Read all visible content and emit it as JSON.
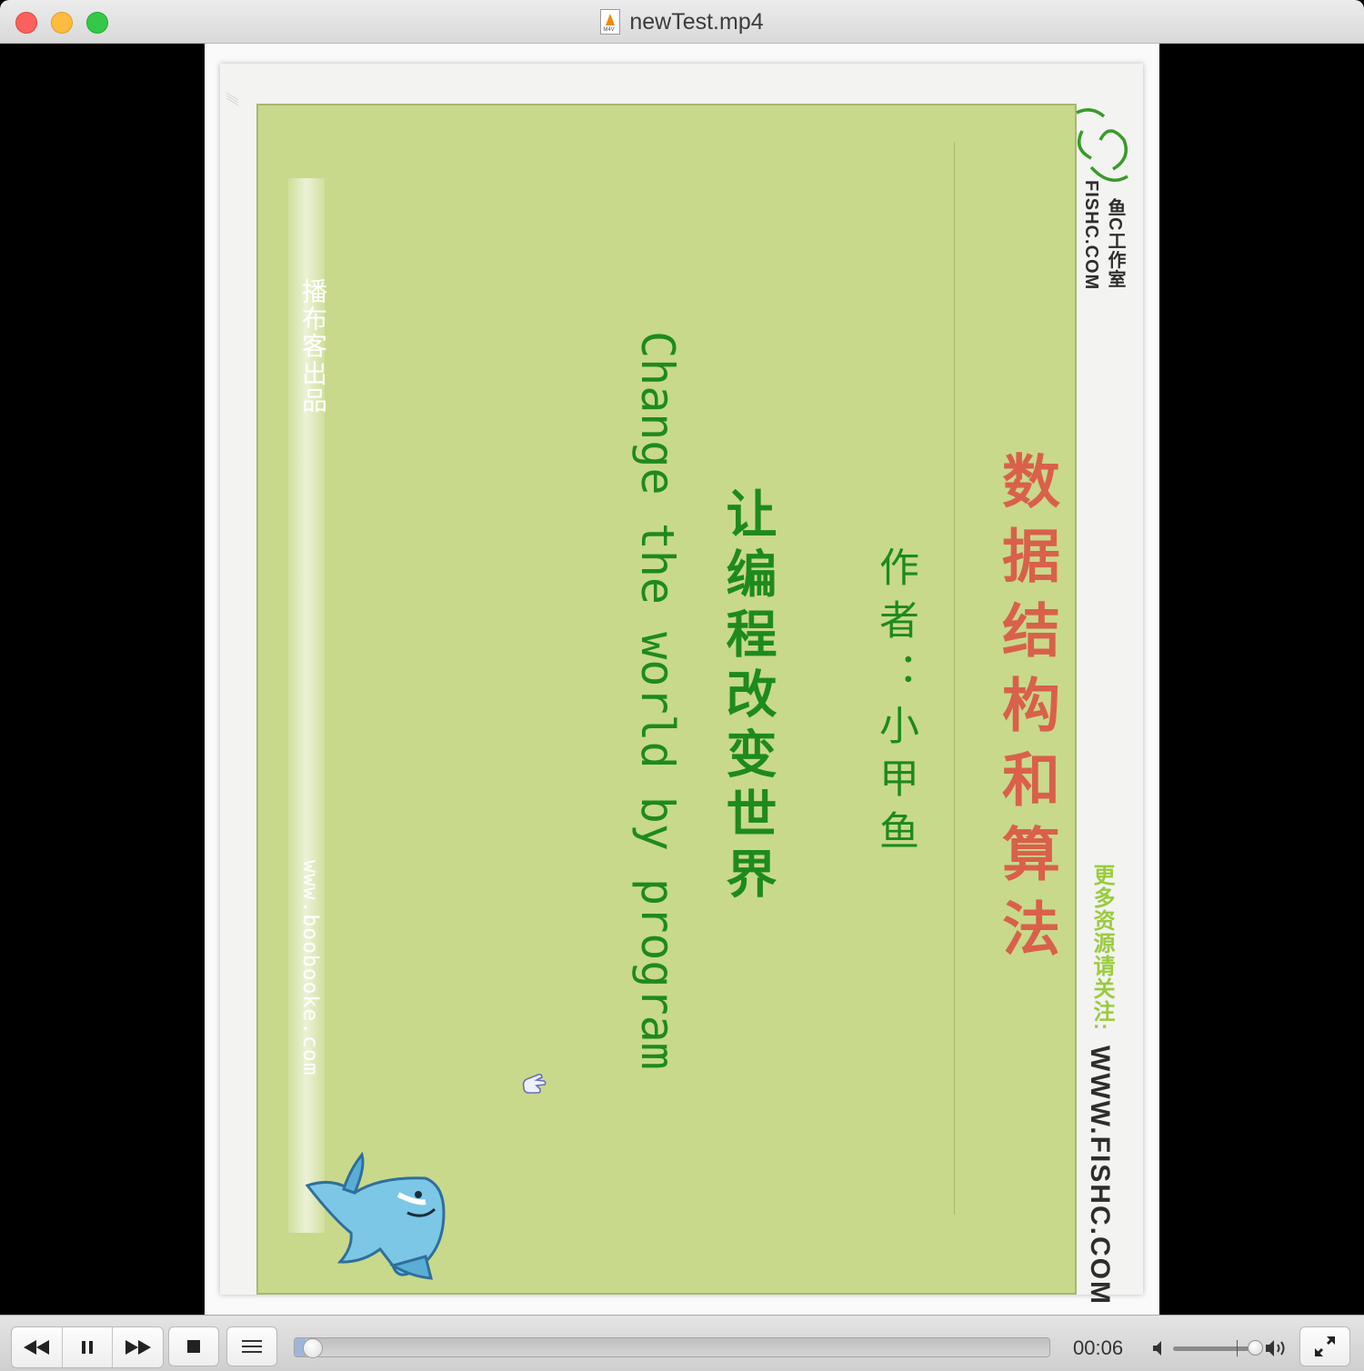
{
  "window": {
    "title": "newTest.mp4",
    "file_icon_tag": "M4V"
  },
  "video_frame": {
    "slide_title": "数据结构和算法",
    "author_line": "作者：小甲鱼",
    "motto_cn": "让编程改变世界",
    "motto_en": "Change the world by program",
    "strip_text": "播布客出品",
    "strip_url": "www.boobooke.com",
    "brand_name": "鱼C工作室",
    "brand_domain": "FISHC.COM",
    "follow_text": "更多资源请关注:",
    "website": "WWW.FISHC.COM"
  },
  "controls": {
    "rewind_icon": "rewind-icon",
    "pause_icon": "pause-icon",
    "forward_icon": "fast-forward-icon",
    "stop_icon": "stop-icon",
    "playlist_icon": "playlist-icon",
    "fullscreen_icon": "fullscreen-icon",
    "elapsed_time": "00:06",
    "seek_progress_fraction": 0.015,
    "volume_fraction": 0.85
  },
  "colors": {
    "slide_bg": "#c8d98b",
    "title_red": "#d9604a",
    "text_green": "#1e8a1e",
    "close": "#fc605c",
    "minimize": "#fdbc40",
    "maximize": "#34c84a"
  }
}
